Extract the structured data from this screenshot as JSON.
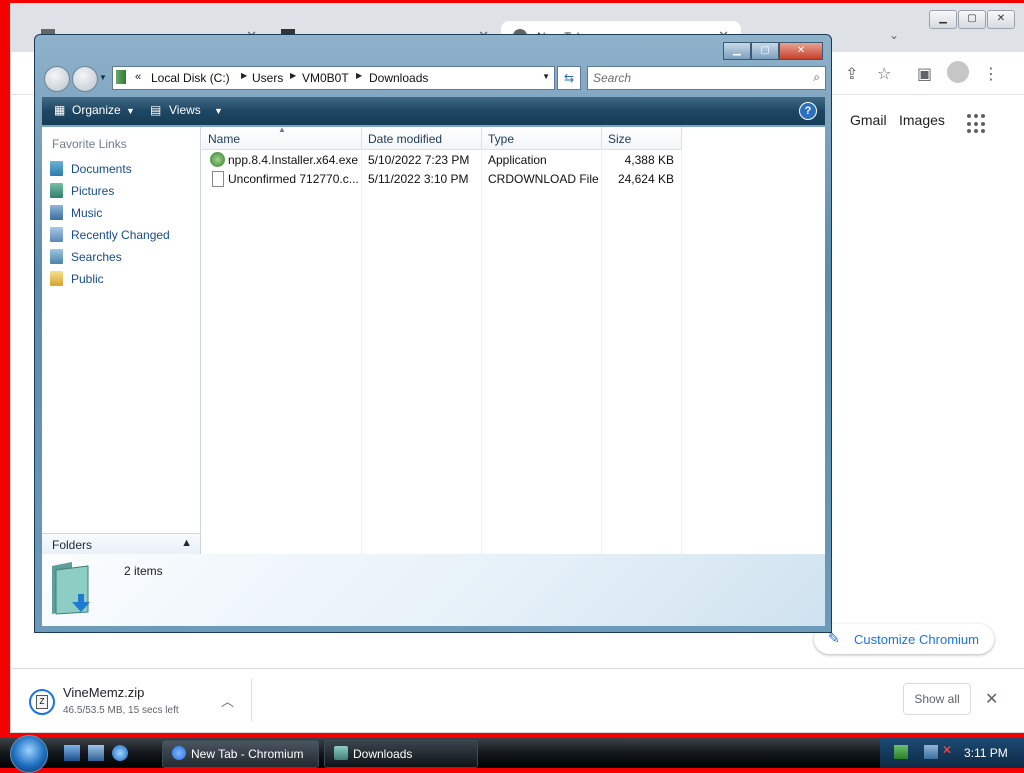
{
  "chrome": {
    "tabs": [
      "",
      "",
      "New Tab"
    ],
    "ntp_links": [
      "Gmail",
      "Images"
    ],
    "customize_label": "Customize Chromium",
    "download": {
      "name": "VineMemz.zip",
      "status": "46.5/53.5 MB, 15 secs left"
    },
    "show_all_label": "Show all"
  },
  "explorer": {
    "address": [
      "Local Disk (C:)",
      "Users",
      "VM0B0T",
      "Downloads"
    ],
    "search_placeholder": "Search",
    "commands": {
      "organize": "Organize",
      "views": "Views"
    },
    "nav": {
      "heading": "Favorite Links",
      "items": [
        {
          "label": "Documents",
          "icon": "documents-icon"
        },
        {
          "label": "Pictures",
          "icon": "pictures-icon"
        },
        {
          "label": "Music",
          "icon": "music-icon"
        },
        {
          "label": "Recently Changed",
          "icon": "recent-icon"
        },
        {
          "label": "Searches",
          "icon": "searches-icon"
        },
        {
          "label": "Public",
          "icon": "public-folder-icon"
        }
      ],
      "folders_label": "Folders"
    },
    "columns": [
      "Name",
      "Date modified",
      "Type",
      "Size"
    ],
    "files": [
      {
        "name": "npp.8.4.Installer.x64.exe",
        "date": "5/10/2022 7:23 PM",
        "type": "Application",
        "size": "4,388 KB",
        "icon": "installer-icon"
      },
      {
        "name": "Unconfirmed 712770.c...",
        "date": "5/11/2022 3:10 PM",
        "type": "CRDOWNLOAD File",
        "size": "24,624 KB",
        "icon": "file-icon"
      }
    ],
    "item_count": "2 items"
  },
  "taskbar": {
    "tasks": [
      "New Tab - Chromium",
      "Downloads"
    ],
    "clock": "3:11 PM"
  }
}
